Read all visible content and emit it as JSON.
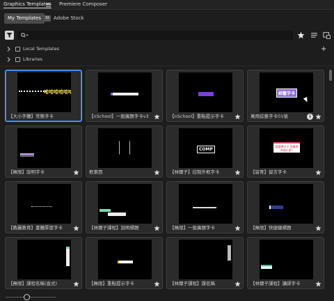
{
  "panel": {
    "tabs": [
      {
        "label": "Graphics Templates"
      },
      {
        "label": "Premiere Composer"
      }
    ]
  },
  "subtabs": {
    "my_templates": "My Templates",
    "adobe_stock": "Adobe Stock",
    "stock_badge": "St"
  },
  "search": {
    "placeholder": "",
    "value": ""
  },
  "folders": [
    {
      "label": "Local Templates"
    },
    {
      "label": "Libraries"
    }
  ],
  "templates": [
    {
      "label": "【大小字體】常態字卡",
      "thumb_text": "哈哈哈哈哈哈",
      "selected": true
    },
    {
      "label": "【nSchool】一般廣題字卡v3",
      "thumb_text": ""
    },
    {
      "label": "【nSchool】重點提示字卡",
      "thumb_text": ""
    },
    {
      "label": "萬用綜藝字卡01號",
      "thumb_text": "綜藝字卡",
      "info": true
    },
    {
      "label": "【無限】說明字卡",
      "thumb_text": ""
    },
    {
      "label": "框東西",
      "thumb_text": ""
    },
    {
      "label": "【林爾子】控制外框字卡",
      "thumb_text": "COMP"
    },
    {
      "label": "【留青】留言字卡",
      "thumb_text": "請選擇字卡 你最想知道什麼?"
    },
    {
      "label": "【教麗教育】書體厚度字卡",
      "thumb_text": ""
    },
    {
      "label": "【林爾子課程】說明標題",
      "thumb_text": ""
    },
    {
      "label": "【無限】一般廣題字卡",
      "thumb_text": ""
    },
    {
      "label": "【無限】快捷鍵標題",
      "thumb_text": ""
    },
    {
      "label": "【無限】課程名稱(直式)",
      "thumb_text": ""
    },
    {
      "label": "【無限】重點提示字卡",
      "thumb_text": ""
    },
    {
      "label": "【林爾子課程】課名稱",
      "thumb_text": ""
    },
    {
      "label": "【林爾子課程】講師字卡",
      "thumb_text": ""
    }
  ],
  "colors": {
    "accent": "#5ea1ff",
    "panel_bg": "#1d1d1d",
    "card_bg": "#2b2b2b"
  },
  "thumbnail_size_slider": {
    "value": 0.42
  }
}
